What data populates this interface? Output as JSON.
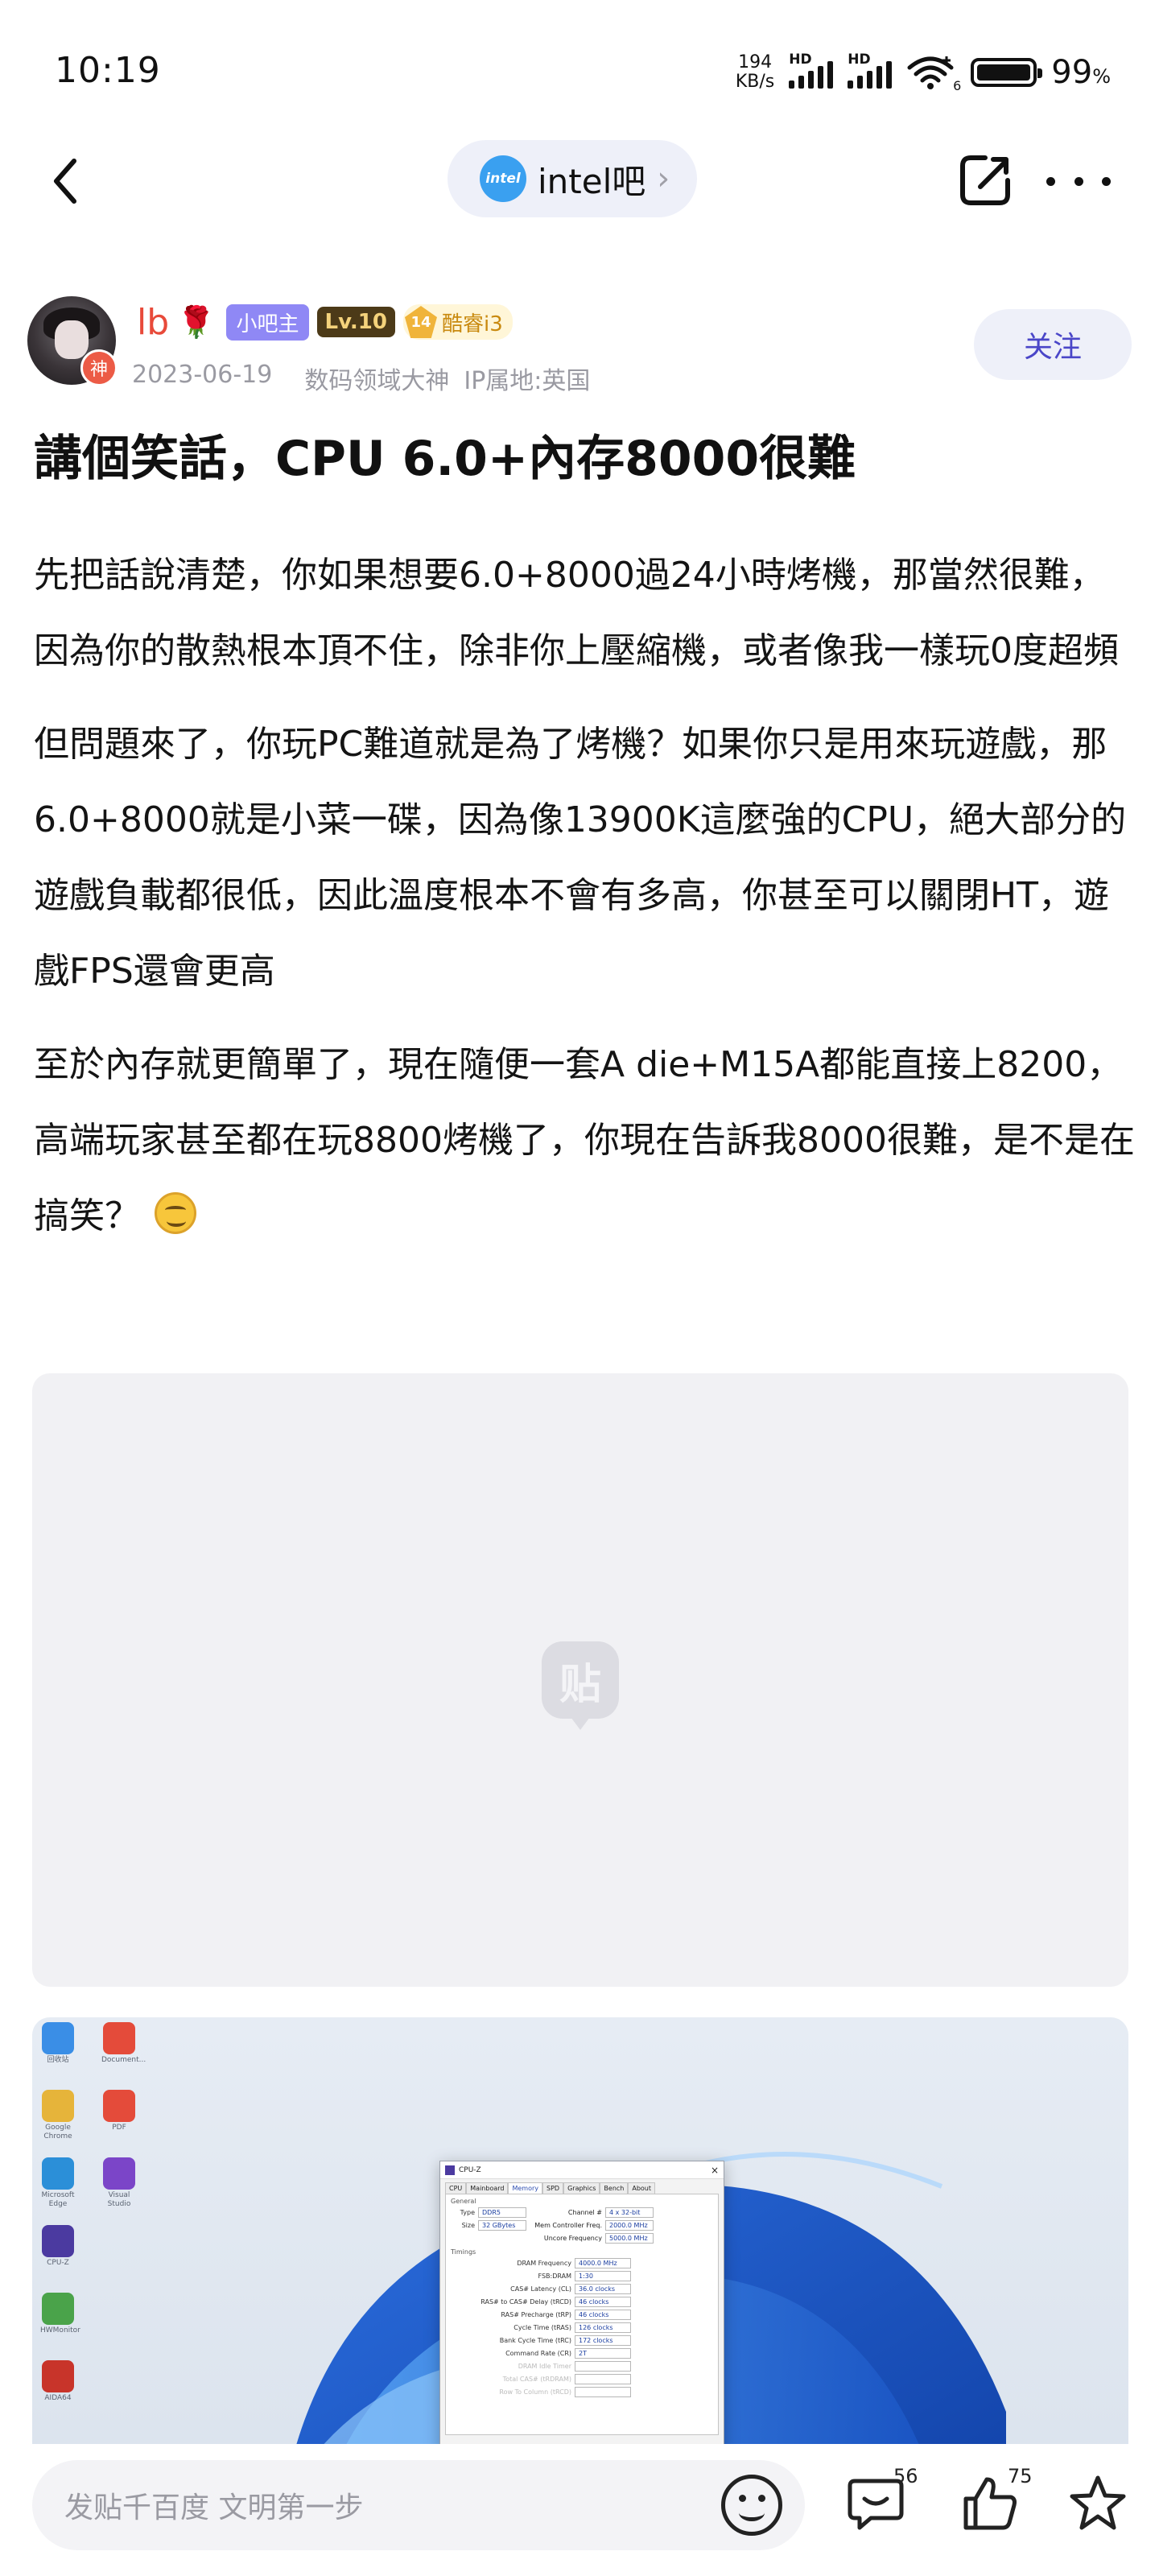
{
  "status_bar": {
    "time": "10:19",
    "net_speed_value": "194",
    "net_speed_unit": "KB/s",
    "signal_1_label": "HD",
    "signal_2_label": "HD",
    "wifi_badge": "6",
    "battery_percent": "99",
    "battery_percent_unit": "%"
  },
  "header": {
    "forum_logo_text": "intel",
    "forum_name": "intel吧",
    "forum_chevron": "›",
    "icons": [
      "back-icon",
      "share-icon",
      "more-icon"
    ]
  },
  "author": {
    "name": "lb",
    "rose_icon": "🌹",
    "avatar_badge": "神",
    "owner_tag": "小吧主",
    "level_tag": "Lv.10",
    "cool_level": "14",
    "cool_tag": "酷睿i3",
    "date": "2023-06-19",
    "title": "数码领域大神",
    "ip_location": "IP属地:英国",
    "follow_label": "关注"
  },
  "post": {
    "title": "講個笑話，CPU 6.0+內存8000很難",
    "paragraphs": [
      "先把話說清楚，你如果想要6.0+8000過24小時烤機，那當然很難，因為你的散熱根本頂不住，除非你上壓縮機，或者像我一樣玩0度超頻",
      "但問題來了，你玩PC難道就是為了烤機？如果你只是用來玩遊戲，那6.0+8000就是小菜一碟，因為像13900K這麼強的CPU，絕大部分的遊戲負載都很低，因此溫度根本不會有多高，你甚至可以關閉HT，遊戲FPS還會更高",
      "至於內存就更簡單了，現在隨便一套A die+M15A都能直接上8200，高端玩家甚至都在玩8800烤機了，你現在告訴我8000很難，是不是在搞笑？"
    ],
    "image_placeholder_logo": "贴"
  },
  "screenshot": {
    "cpuz_title": "CPU-Z",
    "cpuz_close": "×",
    "tabs": [
      "CPU",
      "Mainboard",
      "Memory",
      "SPD",
      "Graphics",
      "Bench",
      "About"
    ],
    "general_label": "General",
    "type_label": "Type",
    "type_value": "DDR5",
    "size_label": "Size",
    "size_value": "32 GBytes",
    "channel_label": "Channel #",
    "channel_value": "4 x 32-bit",
    "mem_ctrl_label": "Mem Controller Freq.",
    "mem_ctrl_value": "2000.0 MHz",
    "uncore_label": "Uncore Frequency",
    "uncore_value": "5000.0 MHz",
    "timings_label": "Timings",
    "timings": [
      {
        "k": "DRAM Frequency",
        "v": "4000.0 MHz"
      },
      {
        "k": "FSB:DRAM",
        "v": "1:30"
      },
      {
        "k": "CAS# Latency (CL)",
        "v": "36.0 clocks"
      },
      {
        "k": "RAS# to CAS# Delay (tRCD)",
        "v": "46 clocks"
      },
      {
        "k": "RAS# Precharge (tRP)",
        "v": "46 clocks"
      },
      {
        "k": "Cycle Time (tRAS)",
        "v": "126 clocks"
      },
      {
        "k": "Bank Cycle Time (tRC)",
        "v": "172 clocks"
      },
      {
        "k": "Command Rate (CR)",
        "v": "2T"
      },
      {
        "k": "DRAM Idle Timer",
        "v": ""
      },
      {
        "k": "Total CAS# (tRDRAM)",
        "v": ""
      },
      {
        "k": "Row To Column (tRCD)",
        "v": ""
      }
    ],
    "desktop_icons": [
      {
        "label": "回收站",
        "color": "#3a8ee6"
      },
      {
        "label": "Document...",
        "color": "#e44b3a"
      },
      {
        "label": "Google Chrome",
        "color": "#e6b43a"
      },
      {
        "label": "PDF",
        "color": "#e44b3a"
      },
      {
        "label": "Microsoft Edge",
        "color": "#2b8fd8"
      },
      {
        "label": "Visual Studio",
        "color": "#7b45c8"
      },
      {
        "label": "CPU-Z",
        "color": "#4b3aa0"
      },
      {
        "label": "HWMonitor",
        "color": "#4aa34a"
      },
      {
        "label": "AIDA64",
        "color": "#c8342a"
      }
    ]
  },
  "bottom_bar": {
    "input_placeholder": "发贴千百度 文明第一步",
    "comment_count": "56",
    "like_count": "75"
  }
}
